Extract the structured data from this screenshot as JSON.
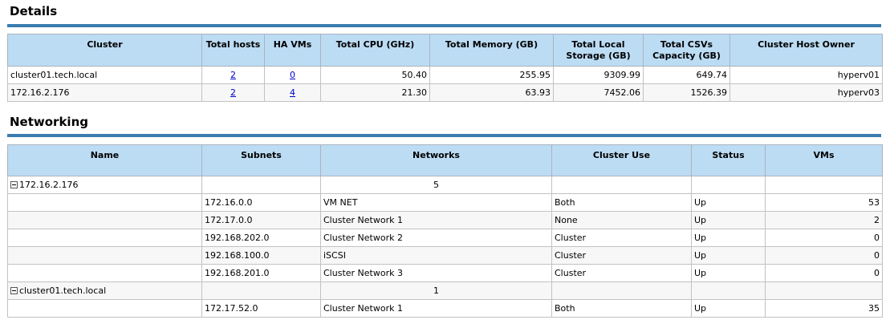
{
  "details": {
    "title": "Details",
    "headers": [
      "Cluster",
      "Total hosts",
      "HA VMs",
      "Total CPU (GHz)",
      "Total Memory (GB)",
      "Total Local Storage (GB)",
      "Total CSVs Capacity (GB)",
      "Cluster Host Owner"
    ],
    "rows": [
      [
        "cluster01.tech.local",
        "2",
        "0",
        "50.40",
        "255.95",
        "9309.99",
        "649.74",
        "hyperv01"
      ],
      [
        "172.16.2.176",
        "2",
        "4",
        "21.30",
        "63.93",
        "7452.06",
        "1526.39",
        "hyperv03"
      ]
    ]
  },
  "networking": {
    "title": "Networking",
    "headers": [
      "Name",
      "Subnets",
      "Networks",
      "Cluster Use",
      "Status",
      "VMs"
    ],
    "groups": [
      {
        "name": "172.16.2.176",
        "count": "5",
        "rows": [
          [
            "",
            "172.16.0.0",
            "VM NET",
            "Both",
            "Up",
            "53"
          ],
          [
            "",
            "172.17.0.0",
            "Cluster Network 1",
            "None",
            "Up",
            "2"
          ],
          [
            "",
            "192.168.202.0",
            "Cluster Network 2",
            "Cluster",
            "Up",
            "0"
          ],
          [
            "",
            "192.168.100.0",
            "iSCSI",
            "Cluster",
            "Up",
            "0"
          ],
          [
            "",
            "192.168.201.0",
            "Cluster Network 3",
            "Cluster",
            "Up",
            "0"
          ]
        ]
      },
      {
        "name": "cluster01.tech.local",
        "count": "1",
        "rows": [
          [
            "",
            "172.17.52.0",
            "Cluster Network 1",
            "Both",
            "Up",
            "35"
          ]
        ]
      }
    ]
  },
  "icons": {
    "expander": "collapse-minus-icon"
  },
  "colors": {
    "header_bg": "#bcdcf4",
    "rule": "#3a7cb0",
    "link": "#0000cc"
  }
}
